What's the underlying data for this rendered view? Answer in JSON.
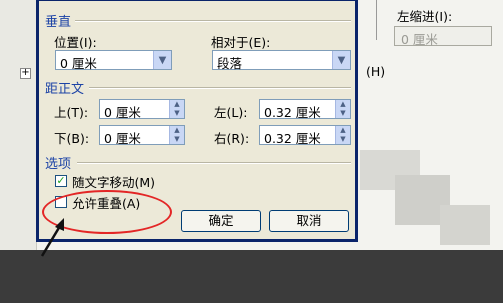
{
  "dialog": {
    "vertical": {
      "title": "垂直",
      "position_label": "位置(I):",
      "position_value": "0 厘米",
      "relative_label": "相对于(E):",
      "relative_value": "段落"
    },
    "distance": {
      "title": "距正文",
      "top_label": "上(T):",
      "top_value": "0 厘米",
      "bottom_label": "下(B):",
      "bottom_value": "0 厘米",
      "left_label": "左(L):",
      "left_value": "0.32 厘米",
      "right_label": "右(R):",
      "right_value": "0.32 厘米"
    },
    "options": {
      "title": "选项",
      "move_with_text_label": "随文字移动(M)",
      "move_with_text_checked": true,
      "allow_overlap_label": "允许重叠(A)",
      "allow_overlap_checked": false
    },
    "ok_label": "确定",
    "cancel_label": "取消"
  },
  "background": {
    "left_indent_label": "左缩进(I):",
    "left_indent_value": "0 厘米",
    "h_label": "(H)",
    "marker_label": "+"
  },
  "annotation_color": "#e32626"
}
